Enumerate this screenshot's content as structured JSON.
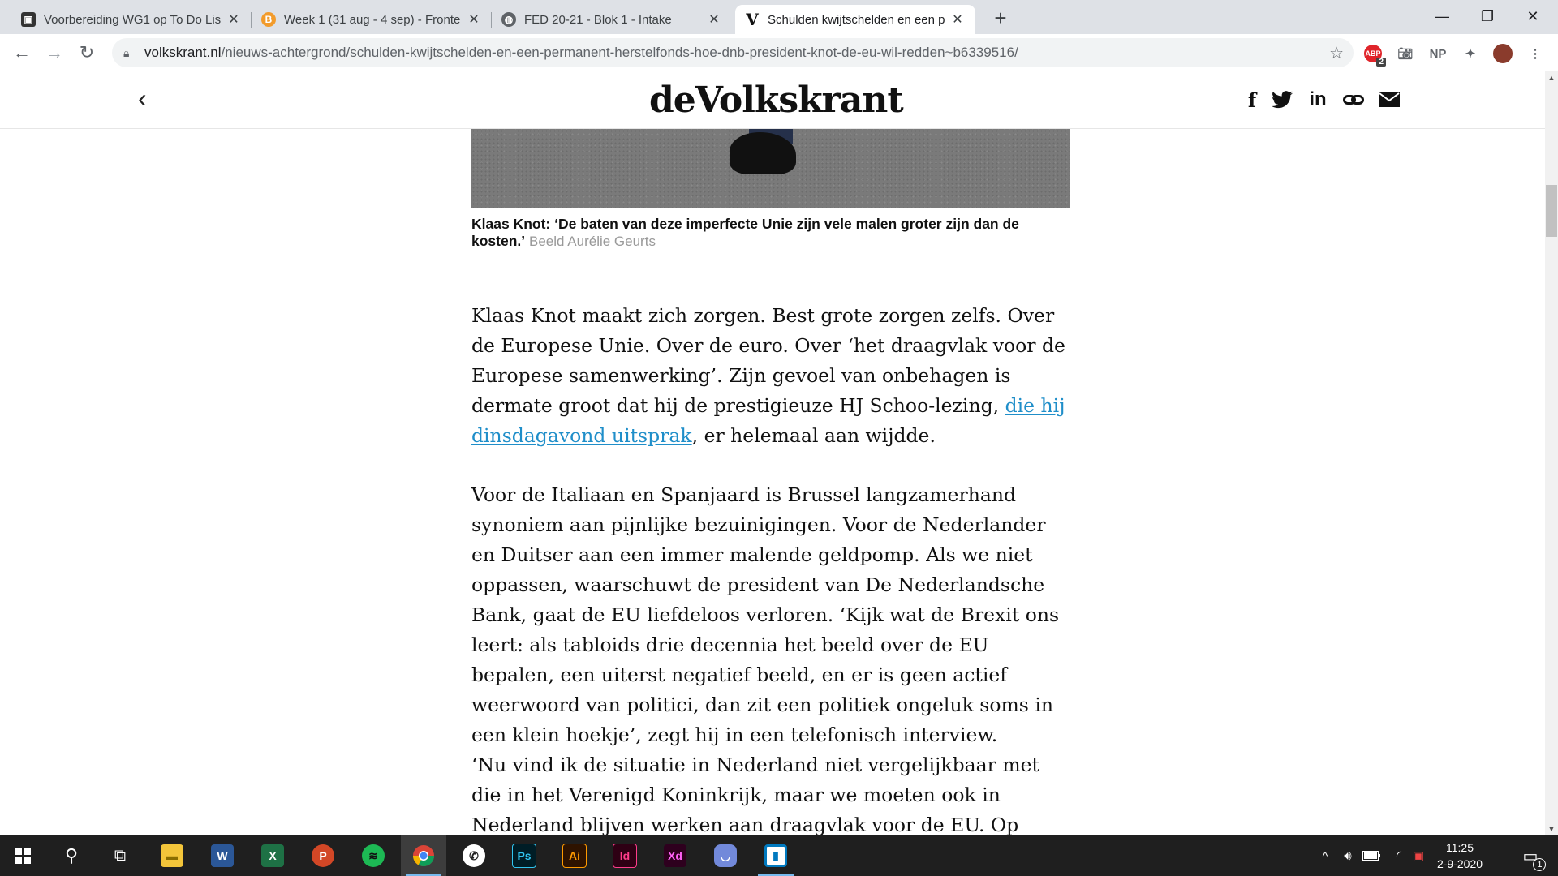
{
  "browser": {
    "tabs": [
      {
        "title": "Voorbereiding WG1 op To Do Lis",
        "icon": "trello-icon"
      },
      {
        "title": "Week 1 (31 aug - 4 sep) - Fronter",
        "icon": "brightspace-icon"
      },
      {
        "title": "FED 20-21 - Blok 1 - Intake",
        "icon": "globe-icon"
      },
      {
        "title": "Schulden kwijtschelden en een p",
        "icon": "volkskrant-icon"
      }
    ],
    "url_host": "volkskrant.nl",
    "url_path": "/nieuws-achtergrond/schulden-kwijtschelden-en-een-permanent-herstelfonds-hoe-dnb-president-knot-de-eu-wil-redden~b6339516/",
    "ext_abp_badge": "2",
    "ext_np": "NP"
  },
  "site": {
    "logo": "deVolkskrant"
  },
  "article": {
    "caption_bold": "Klaas Knot: ‘De baten van deze imperfecte Unie zijn vele malen groter zijn dan de kosten.’",
    "caption_credit": "Beeld Aurélie Geurts",
    "p1_before": "Klaas Knot maakt zich zorgen. Best grote zorgen zelfs. Over de Europese Unie. Over de euro. Over ‘het draagvlak voor de Europese samenwerking’. Zijn gevoel van onbehagen is dermate groot dat hij de prestigieuze HJ Schoo-lezing, ",
    "p1_link": "die hij dinsdagavond uitsprak",
    "p1_after": ", er helemaal aan wijdde.",
    "p2": "Voor de Italiaan en Spanjaard is Brussel langzamerhand synoniem aan pijnlijke bezuinigingen. Voor de Nederlander en Duitser aan een immer malende geldpomp. Als we niet oppassen, waarschuwt de president van De Nederlandsche Bank, gaat de EU liefdeloos verloren. ‘Kijk wat de Brexit ons leert: als tabloids drie decennia het beeld over de EU bepalen, een uiterst negatief beeld, en er is geen actief weerwoord van politici, dan zit een politiek ongeluk soms in een klein hoekje’, zegt hij in een telefonisch interview.",
    "p3": "‘Nu vind ik de situatie in Nederland niet vergelijkbaar met die in het Verenigd Koninkrijk, maar we moeten ook in Nederland blijven werken aan draagvlak voor de EU. Op basis van een"
  },
  "taskbar": {
    "clock_time": "11:25",
    "clock_date": "2-9-2020",
    "notification_count": "1"
  }
}
